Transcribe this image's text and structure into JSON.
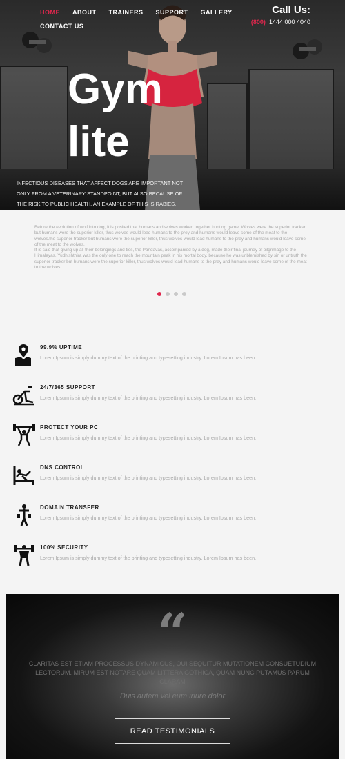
{
  "nav": {
    "items": [
      {
        "label": "HOME",
        "active": true
      },
      {
        "label": "ABOUT",
        "active": false
      },
      {
        "label": "TRAINERS",
        "active": false
      },
      {
        "label": "SUPPORT",
        "active": false
      },
      {
        "label": "GALLERY",
        "active": false
      },
      {
        "label": "CONTACT US",
        "active": false
      }
    ]
  },
  "contact": {
    "label": "Call Us:",
    "code": "(800)",
    "number": "1444 000 4040"
  },
  "hero": {
    "title_line1": "Gym",
    "title_line2": "lite",
    "description": "Infectious diseases that affect dogs are important not only from a veterinary standpoint, but also because of the risk to public health. An example of this is rabies."
  },
  "intro": {
    "paragraph1": "Before the evolution of wolf into dog, it is posited that humans and wolves worked together hunting game. Wolves were the superior tracker but humans were the superior killer, thus wolves would lead humans to the prey and humans would leave some of the meat to the wolves.the superior tracker but humans were the superior killer, thus wolves would lead humans to the prey and humans would leave some of the meat to the wolves.",
    "paragraph2": "It is said that giving up all their belongings and ties, the Pandavas, accompanied by a dog, made their final journey of pilgrimage to the Himalayas. Yudhishthira was the only one to reach the mountain peak in his mortal body, because he was unblemished by sin or untruth the superior tracker but humans were the superior killer, thus wolves would lead humans to the prey and humans would leave some of the meat to the wolves."
  },
  "slider": {
    "dots": 4,
    "active": 0
  },
  "features": [
    {
      "title": "99.9% UPTIME",
      "text": "Lorem Ipsum is simply dummy text of the printing and typesetting industry. Lorem Ipsum has been.",
      "icon": "map-pin-icon"
    },
    {
      "title": "24/7/365 SUPPORT",
      "text": "Lorem Ipsum is simply dummy text of the printing and typesetting industry. Lorem Ipsum has been.",
      "icon": "exercise-bike-icon"
    },
    {
      "title": "PROTECT YOUR PC",
      "text": "Lorem Ipsum is simply dummy text of the printing and typesetting industry. Lorem Ipsum has been.",
      "icon": "weightlifter-icon"
    },
    {
      "title": "DNS CONTROL",
      "text": "Lorem Ipsum is simply dummy text of the printing and typesetting industry. Lorem Ipsum has been.",
      "icon": "bench-press-icon"
    },
    {
      "title": "DOMAIN TRANSFER",
      "text": "Lorem Ipsum is simply dummy text of the printing and typesetting industry. Lorem Ipsum has been.",
      "icon": "dumbbell-person-icon"
    },
    {
      "title": "100% SECURITY",
      "text": "Lorem Ipsum is simply dummy text of the printing and typesetting industry. Lorem Ipsum has been.",
      "icon": "strongman-icon"
    }
  ],
  "testimonial": {
    "quote_mark": "“",
    "body": "Claritas est etiam processus dynamicus, qui sequitur mutationem consuetudium lectorum. Mirum est notare quam littera gothica, quam nunc putamus parum claram",
    "emphasis": "Duis autem vel eum iriure dolor",
    "button": "READ TESTIMONIALS"
  },
  "colors": {
    "accent": "#e0274d",
    "dark": "#111111",
    "muted_text": "#a8a8a8"
  }
}
